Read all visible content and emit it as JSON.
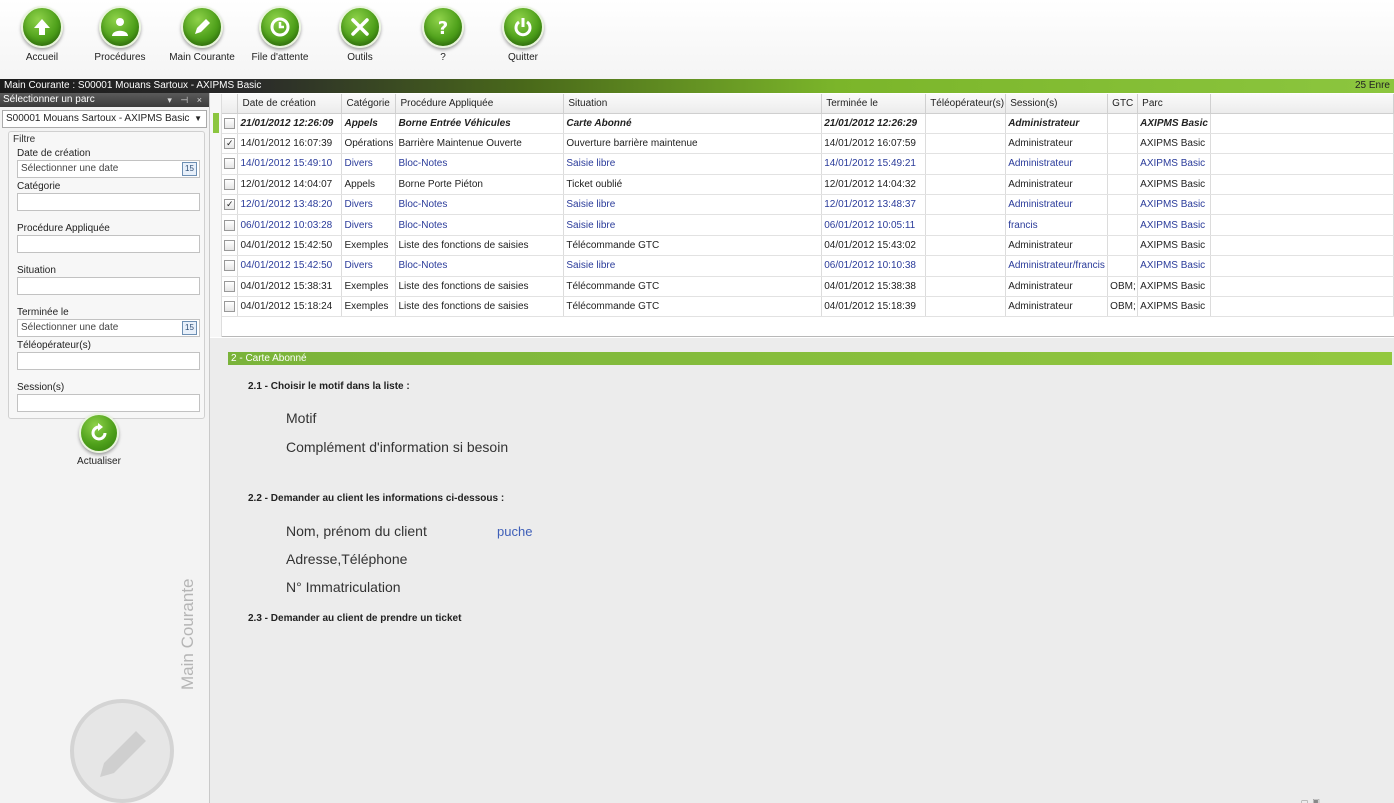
{
  "toolbar": {
    "buttons": [
      {
        "label": "Accueil",
        "icon": "arrow-up-icon"
      },
      {
        "label": "Procédures",
        "icon": "people-icon"
      },
      {
        "label": "Main Courante",
        "icon": "pencil-icon"
      },
      {
        "label": "File d'attente",
        "icon": "clock-icon"
      },
      {
        "label": "Outils",
        "icon": "tools-icon"
      },
      {
        "label": "?",
        "icon": "help-icon"
      },
      {
        "label": "Quitter",
        "icon": "power-icon"
      }
    ]
  },
  "titlebar": {
    "title": "Main Courante : S00001  Mouans Sartoux - AXIPMS Basic",
    "count": "25 Enre"
  },
  "leftpanel": {
    "header": "Sélectionner un parc",
    "pins": "▾ ⊣ ×",
    "selected_parc": "S00001 Mouans Sartoux - AXIPMS Basic",
    "filter_title": "Filtre",
    "date_creation_label": "Date de création",
    "date_creation_placeholder": "Sélectionner une date",
    "categorie_label": "Catégorie",
    "procedure_label": "Procédure Appliquée",
    "situation_label": "Situation",
    "terminee_label": "Terminée le",
    "terminee_placeholder": "Sélectionner une date",
    "teleoperateur_label": "Téléopérateur(s)",
    "session_label": "Session(s)",
    "calendar_text": "15",
    "refresh_label": "Actualiser",
    "watermark_text": "Main Courante"
  },
  "grid": {
    "columns": [
      "Date de création",
      "Catégorie",
      "Procédure Appliquée",
      "Situation",
      "Terminée le",
      "Téléopérateur(s)",
      "Session(s)",
      "GTC",
      "Parc"
    ],
    "rows": [
      {
        "checked": false,
        "style": "bold",
        "cells": [
          "21/01/2012 12:26:09",
          "Appels",
          "Borne Entrée Véhicules",
          "Carte Abonné",
          "21/01/2012 12:26:29",
          "",
          "Administrateur",
          "",
          "AXIPMS Basic"
        ]
      },
      {
        "checked": true,
        "style": "normal",
        "cells": [
          "14/01/2012 16:07:39",
          "Opérations",
          "Barrière Maintenue Ouverte",
          "Ouverture barrière maintenue",
          "14/01/2012 16:07:59",
          "",
          "Administrateur",
          "",
          "AXIPMS Basic"
        ]
      },
      {
        "checked": false,
        "style": "blue",
        "cells": [
          "14/01/2012 15:49:10",
          "Divers",
          "Bloc-Notes",
          "Saisie libre",
          "14/01/2012 15:49:21",
          "",
          "Administrateur",
          "",
          "AXIPMS Basic"
        ]
      },
      {
        "checked": false,
        "style": "normal",
        "cells": [
          "12/01/2012 14:04:07",
          "Appels",
          "Borne Porte Piéton",
          "Ticket oublié",
          "12/01/2012 14:04:32",
          "",
          "Administrateur",
          "",
          "AXIPMS Basic"
        ]
      },
      {
        "checked": true,
        "style": "blue",
        "cells": [
          "12/01/2012 13:48:20",
          "Divers",
          "Bloc-Notes",
          "Saisie libre",
          "12/01/2012 13:48:37",
          "",
          "Administrateur",
          "",
          "AXIPMS Basic"
        ]
      },
      {
        "checked": false,
        "style": "blue",
        "cells": [
          "06/01/2012 10:03:28",
          "Divers",
          "Bloc-Notes",
          "Saisie libre",
          "06/01/2012 10:05:11",
          "",
          "francis",
          "",
          "AXIPMS Basic"
        ]
      },
      {
        "checked": false,
        "style": "normal",
        "cells": [
          "04/01/2012 15:42:50",
          "Exemples",
          "Liste des fonctions de saisies",
          "Télécommande GTC",
          "04/01/2012 15:43:02",
          "",
          "Administrateur",
          "",
          "AXIPMS Basic"
        ]
      },
      {
        "checked": false,
        "style": "blue",
        "cells": [
          "04/01/2012 15:42:50",
          "Divers",
          "Bloc-Notes",
          "Saisie libre",
          "06/01/2012 10:10:38",
          "",
          "Administrateur/francis",
          "",
          "AXIPMS Basic"
        ]
      },
      {
        "checked": false,
        "style": "normal",
        "cells": [
          "04/01/2012 15:38:31",
          "Exemples",
          "Liste des fonctions de saisies",
          "Télécommande GTC",
          "04/01/2012 15:38:38",
          "",
          "Administrateur",
          "OBM;",
          "AXIPMS Basic"
        ]
      },
      {
        "checked": false,
        "style": "normal",
        "cells": [
          "04/01/2012 15:18:24",
          "Exemples",
          "Liste des fonctions de saisies",
          "Télécommande GTC",
          "04/01/2012 15:18:39",
          "",
          "Administrateur",
          "OBM;",
          "AXIPMS Basic"
        ]
      }
    ]
  },
  "detail": {
    "header": "2 - Carte Abonné",
    "step1": "2.1 - Choisir le motif dans la liste :",
    "motif": "Motif",
    "complement": "Complément d'information si besoin",
    "step2": "2.2 - Demander au client les informations ci-dessous :",
    "nom": "Nom, prénom du client",
    "nom_value": "puche",
    "adresse": "Adresse,Téléphone",
    "immatriculation": "N° Immatriculation",
    "step3": "2.3 - Demander au client de prendre un ticket"
  },
  "colors": {
    "accent_green": "#8cc63f",
    "link_blue": "#2a3b9a"
  }
}
